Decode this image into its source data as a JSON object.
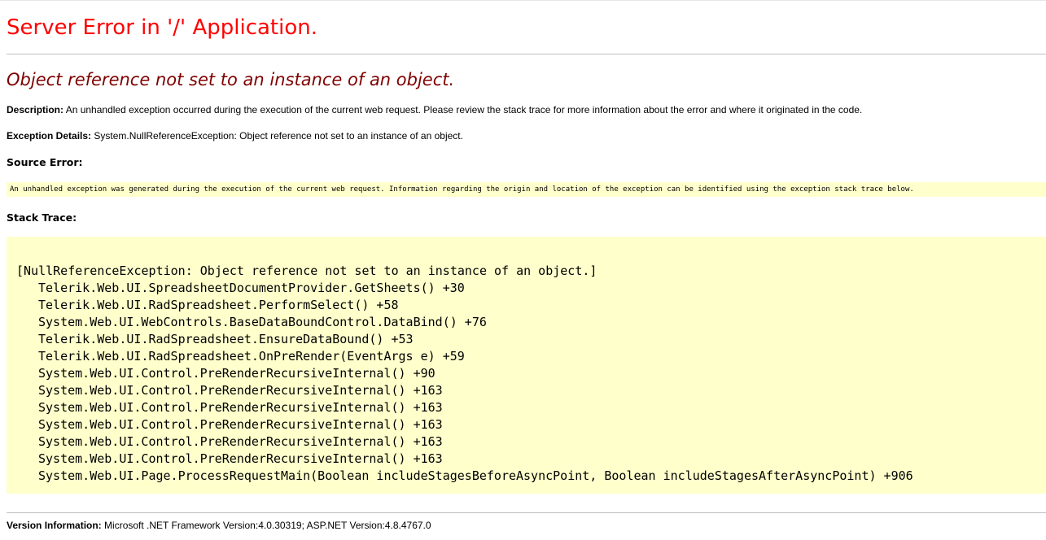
{
  "title": "Server Error in '/' Application.",
  "error_message": "Object reference not set to an instance of an object.",
  "description": {
    "label": "Description:",
    "text": "An unhandled exception occurred during the execution of the current web request. Please review the stack trace for more information about the error and where it originated in the code."
  },
  "exception_details": {
    "label": "Exception Details:",
    "text": "System.NullReferenceException: Object reference not set to an instance of an object."
  },
  "source_error": {
    "label": "Source Error:",
    "text": "An unhandled exception was generated during the execution of the current web request. Information regarding the origin and location of the exception can be identified using the exception stack trace below."
  },
  "stack_trace": {
    "label": "Stack Trace:",
    "header": "[NullReferenceException: Object reference not set to an instance of an object.]",
    "frames": [
      "Telerik.Web.UI.SpreadsheetDocumentProvider.GetSheets() +30",
      "Telerik.Web.UI.RadSpreadsheet.PerformSelect() +58",
      "System.Web.UI.WebControls.BaseDataBoundControl.DataBind() +76",
      "Telerik.Web.UI.RadSpreadsheet.EnsureDataBound() +53",
      "Telerik.Web.UI.RadSpreadsheet.OnPreRender(EventArgs e) +59",
      "System.Web.UI.Control.PreRenderRecursiveInternal() +90",
      "System.Web.UI.Control.PreRenderRecursiveInternal() +163",
      "System.Web.UI.Control.PreRenderRecursiveInternal() +163",
      "System.Web.UI.Control.PreRenderRecursiveInternal() +163",
      "System.Web.UI.Control.PreRenderRecursiveInternal() +163",
      "System.Web.UI.Control.PreRenderRecursiveInternal() +163",
      "System.Web.UI.Page.ProcessRequestMain(Boolean includeStagesBeforeAsyncPoint, Boolean includeStagesAfterAsyncPoint) +906"
    ]
  },
  "version_info": {
    "label": "Version Information:",
    "text": "Microsoft .NET Framework Version:4.0.30319; ASP.NET Version:4.8.4767.0"
  },
  "colors": {
    "title": "#ff0000",
    "error_message": "#800000",
    "code_background": "#ffffcc"
  }
}
